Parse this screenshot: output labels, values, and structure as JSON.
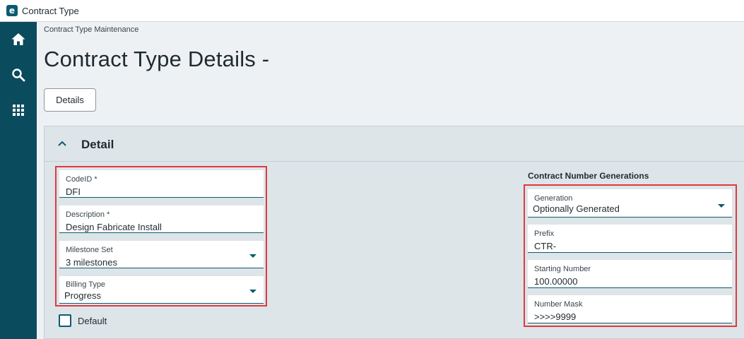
{
  "window": {
    "title": "Contract Type",
    "logo_letter": "e"
  },
  "sidebar": {
    "items": [
      {
        "name": "home",
        "icon": "home-icon"
      },
      {
        "name": "search",
        "icon": "search-icon"
      },
      {
        "name": "apps",
        "icon": "grid-icon"
      }
    ]
  },
  "breadcrumb": "Contract Type Maintenance",
  "page_title": "Contract Type Details -",
  "tabs": [
    {
      "label": "Details"
    }
  ],
  "detail_section": {
    "title": "Detail",
    "left_fields": {
      "code_id": {
        "label": "CodeID *",
        "value": "DFI"
      },
      "description": {
        "label": "Description *",
        "value": "Design Fabricate Install"
      },
      "milestone_set": {
        "label": "Milestone Set",
        "value": "3 milestones"
      },
      "billing_type": {
        "label": "Billing Type",
        "value": "Progress"
      }
    },
    "default_checkbox": {
      "label": "Default",
      "checked": false
    },
    "contract_number_generations": {
      "title": "Contract Number Generations",
      "generation": {
        "label": "Generation",
        "value": "Optionally Generated"
      },
      "prefix": {
        "label": "Prefix",
        "value": "CTR-"
      },
      "starting_number": {
        "label": "Starting Number",
        "value": "100.00000"
      },
      "number_mask": {
        "label": "Number Mask",
        "value": ">>>>9999"
      }
    }
  },
  "colors": {
    "sidebar": "#0b4b5e",
    "accent": "#0d5a70",
    "highlight": "#e0393e",
    "panel": "#dde5e9",
    "page": "#eef1f4"
  }
}
